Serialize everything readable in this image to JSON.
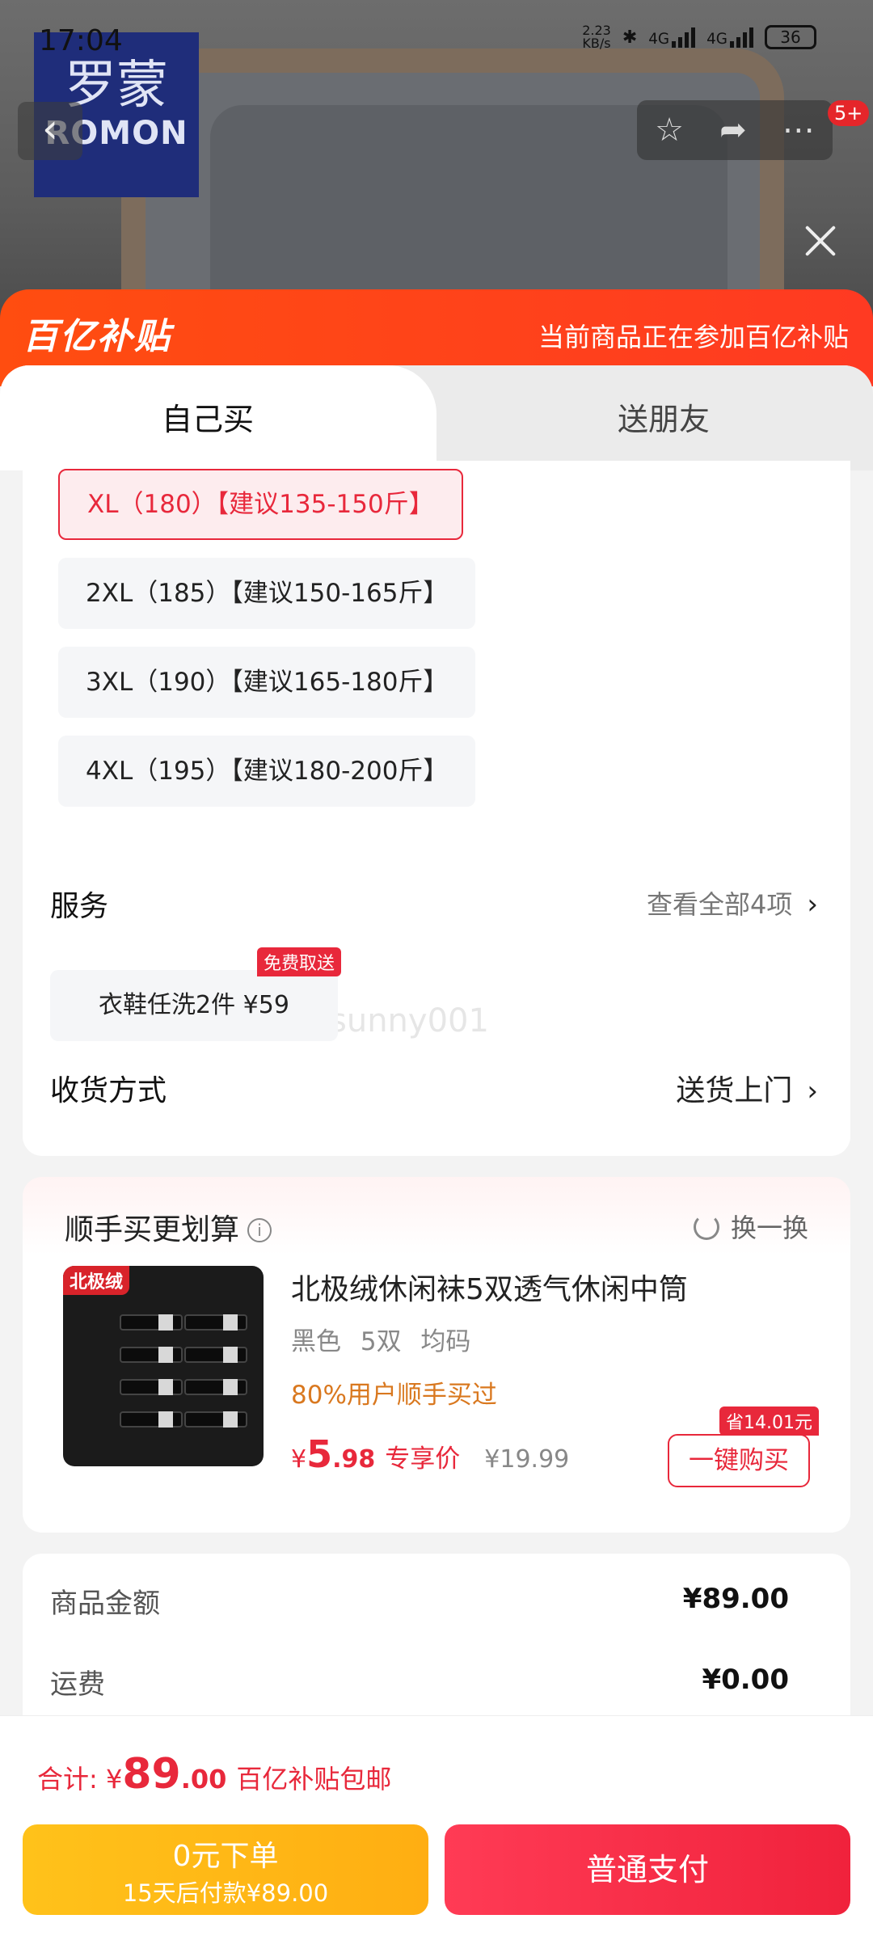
{
  "status_bar": {
    "time": "17:04",
    "net_speed_value": "2.23",
    "net_speed_unit": "KB/s",
    "signal1_label": "4G",
    "signal2_label": "4G",
    "battery": "36"
  },
  "brand": {
    "name_cn": "罗蒙",
    "name_en": "ROMON"
  },
  "nav": {
    "message_badge": "5+"
  },
  "banner": {
    "logo_text": "百亿补贴",
    "text": "当前商品正在参加百亿补贴"
  },
  "tabs": [
    {
      "label": "自己买",
      "active": true
    },
    {
      "label": "送朋友",
      "active": false
    }
  ],
  "sizes": [
    {
      "label": "XL（180）【建议135-150斤】",
      "selected": true
    },
    {
      "label": "2XL（185）【建议150-165斤】",
      "selected": false
    },
    {
      "label": "3XL（190）【建议165-180斤】",
      "selected": false
    },
    {
      "label": "4XL（195）【建议180-200斤】",
      "selected": false
    }
  ],
  "service": {
    "title": "服务",
    "view_all": "查看全部4项",
    "item_label": "衣鞋任洗2件  ¥59",
    "item_tag": "免费取送"
  },
  "watermark": "sunny001",
  "delivery": {
    "title": "收货方式",
    "value": "送货上门"
  },
  "addon": {
    "title": "顺手买更划算",
    "refresh": "换一换",
    "product": {
      "image_logo": "北极绒",
      "name": "北极绒休闲袜5双透气休闲中筒",
      "spec": "黑色 5双 均码",
      "hot": "80%用户顺手买过",
      "price_symbol": "¥",
      "price_int": "5",
      "price_dec": ".98",
      "price_label": "专享价",
      "orig_price": "¥19.99",
      "buy_label": "一键购买",
      "save_tag": "省14.01元"
    }
  },
  "summary": {
    "goods_label": "商品金额",
    "goods_value": "¥89.00",
    "shipping_label": "运费",
    "shipping_value": "¥0.00"
  },
  "footer": {
    "total_label": "合计: ¥",
    "total_int": "89",
    "total_dec": ".00",
    "total_note": "百亿补贴包邮",
    "zero_btn_line1": "0元下单",
    "zero_btn_line2": "15天后付款¥89.00",
    "pay_btn": "普通支付"
  },
  "colors": {
    "accent_red": "#e8283b",
    "banner_orange": "#ff4d10",
    "zero_btn_yellow": "#ffb814",
    "hot_orange": "#d9781f"
  }
}
